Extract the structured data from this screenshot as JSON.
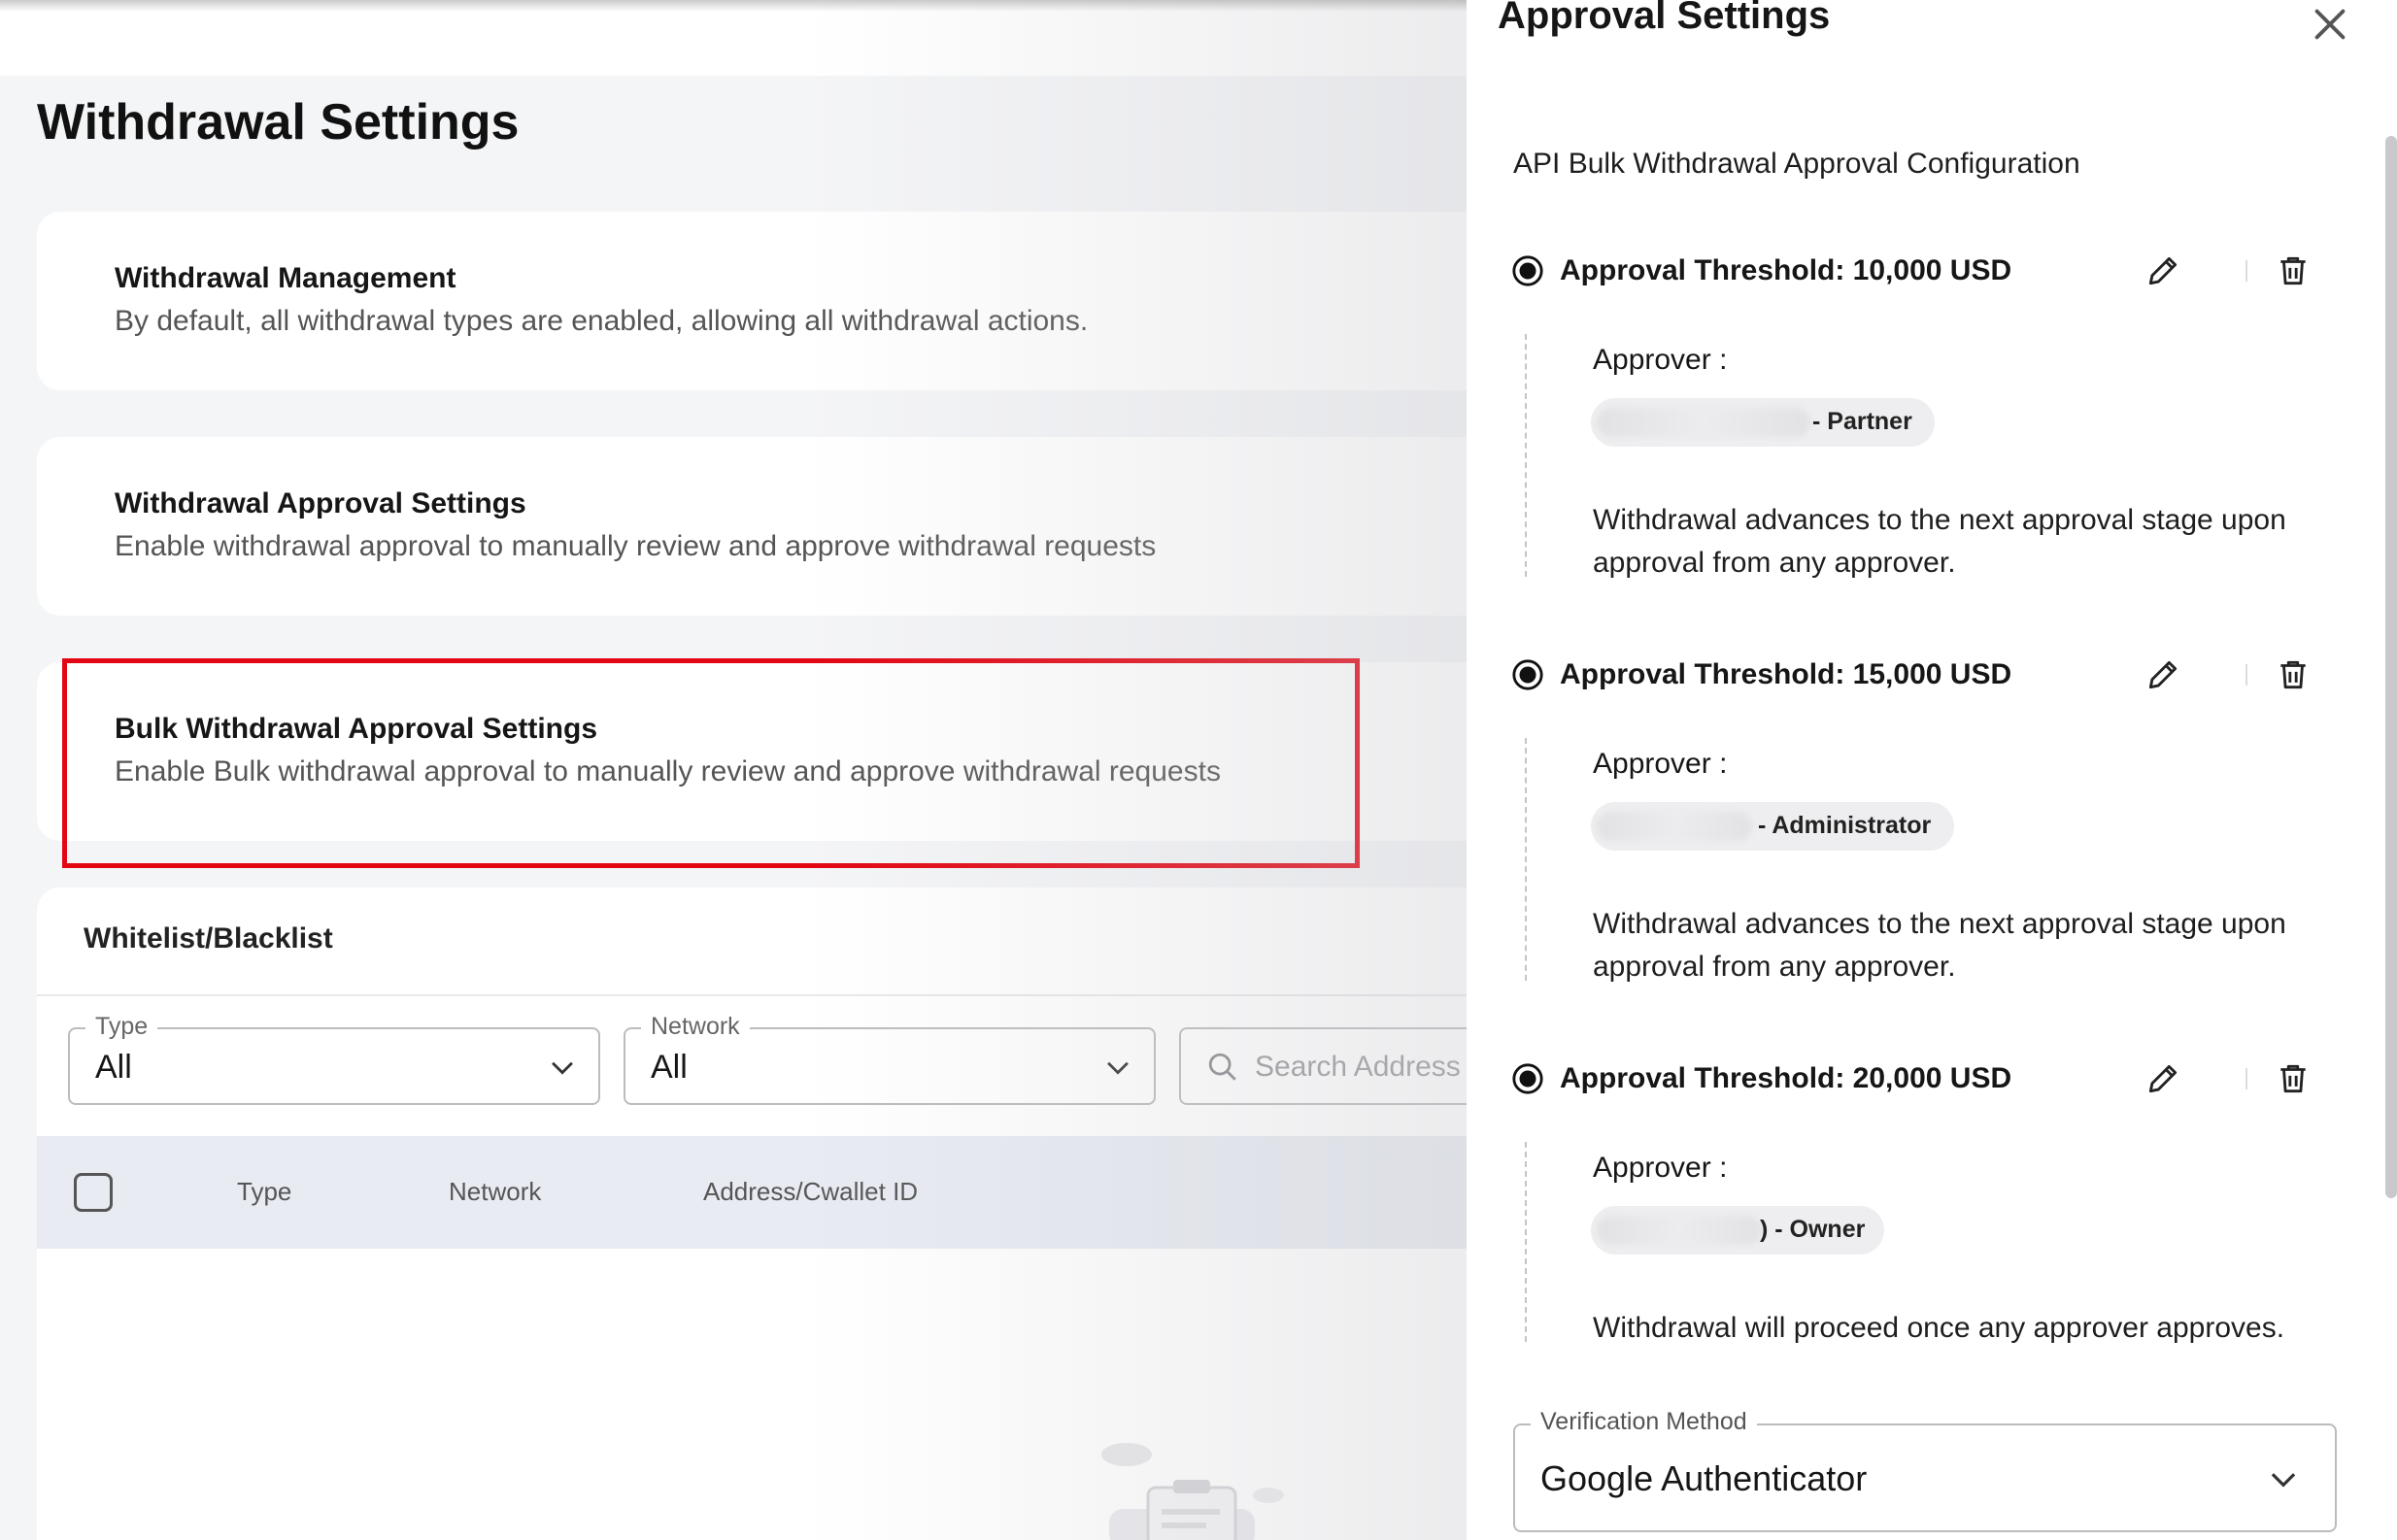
{
  "page": {
    "title": "Withdrawal Settings",
    "cards": [
      {
        "title": "Withdrawal Management",
        "desc": "By default, all withdrawal types are enabled, allowing all withdrawal actions."
      },
      {
        "title": "Withdrawal Approval Settings",
        "desc": "Enable withdrawal approval to manually review and approve withdrawal requests"
      },
      {
        "title": "Bulk Withdrawal Approval Settings",
        "desc": "Enable Bulk withdrawal approval to manually review and approve withdrawal requests"
      }
    ],
    "highlight_color": "#e30613",
    "whitelist": {
      "title": "Whitelist/Blacklist",
      "type_filter": {
        "label": "Type",
        "value": "All"
      },
      "network_filter": {
        "label": "Network",
        "value": "All"
      },
      "search": {
        "placeholder": "Search Address"
      },
      "columns": [
        "Type",
        "Network",
        "Address/Cwallet ID"
      ]
    }
  },
  "drawer": {
    "title": "Approval Settings",
    "subtitle": "API Bulk Withdrawal Approval Configuration",
    "approver_label": "Approver :",
    "thresholds": [
      {
        "label": "Approval Threshold: 10,000 USD",
        "approver_role": "- Partner",
        "note": "Withdrawal advances to the next approval stage upon approval from any approver."
      },
      {
        "label": "Approval Threshold: 15,000 USD",
        "approver_role": "- Administrator",
        "note": "Withdrawal advances to the next approval stage upon approval from any approver."
      },
      {
        "label": "Approval Threshold: 20,000 USD",
        "approver_role": ") - Owner",
        "note": "Withdrawal will proceed once any approver approves."
      }
    ],
    "verification": {
      "label": "Verification Method",
      "value": "Google Authenticator"
    }
  },
  "icons": [
    "close-icon",
    "radio-selected-icon",
    "pencil-icon",
    "trash-icon",
    "search-icon",
    "chevron-down-icon",
    "empty-state-icon"
  ]
}
